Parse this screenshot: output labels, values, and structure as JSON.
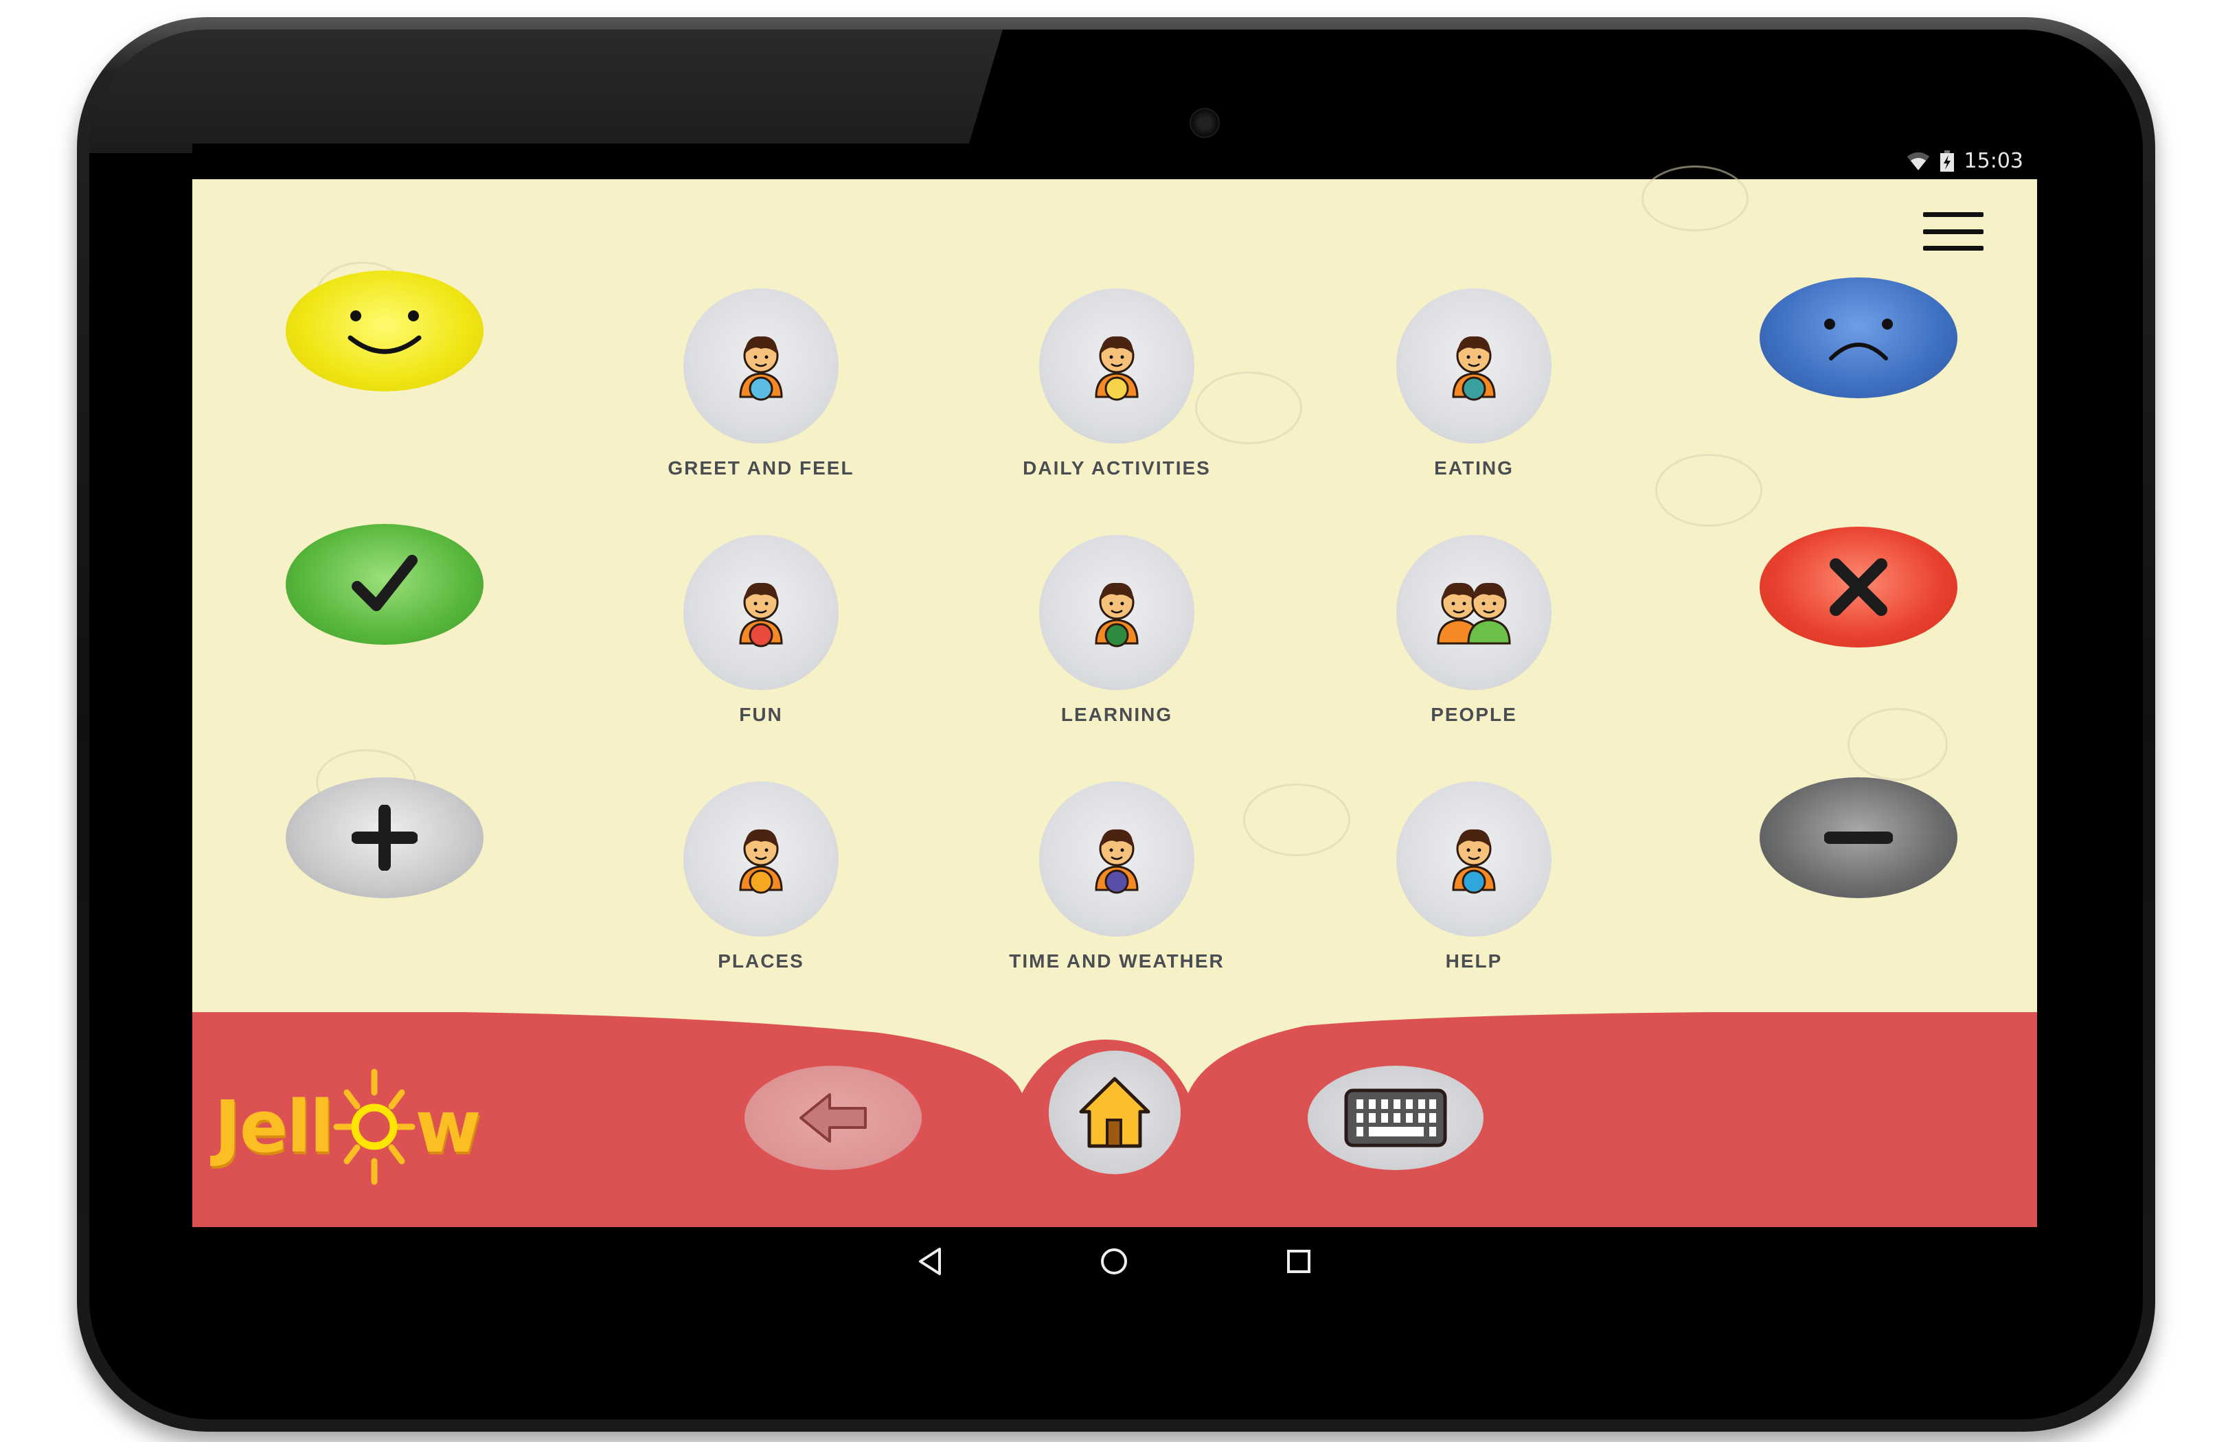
{
  "status_bar": {
    "time": "15:03",
    "icons": [
      "wifi-icon",
      "battery-charging-icon"
    ]
  },
  "header": {
    "menu_icon": "hamburger-menu-icon"
  },
  "left_actions": [
    {
      "name": "like",
      "icon": "smiley-face-icon",
      "color": "#f2ea12"
    },
    {
      "name": "yes",
      "icon": "checkmark-icon",
      "color": "#56b63d"
    },
    {
      "name": "more",
      "icon": "plus-icon",
      "color": "#c6c7c9"
    }
  ],
  "right_actions": [
    {
      "name": "dislike",
      "icon": "sad-face-icon",
      "color": "#3e6fc0"
    },
    {
      "name": "no",
      "icon": "x-icon",
      "color": "#e8402e"
    },
    {
      "name": "less",
      "icon": "minus-icon",
      "color": "#6a6b6d"
    }
  ],
  "categories": [
    {
      "label": "GREET AND FEEL",
      "icon": "boy-holding-hi-sign-icon",
      "accent": "#5bbce4"
    },
    {
      "label": "DAILY ACTIVITIES",
      "icon": "boy-with-toothbrush-icon",
      "accent": "#f5d34a"
    },
    {
      "label": "EATING",
      "icon": "boy-with-fork-spoon-icon",
      "accent": "#3aa0a0"
    },
    {
      "label": "FUN",
      "icon": "boy-with-beach-ball-icon",
      "accent": "#e84a3c"
    },
    {
      "label": "LEARNING",
      "icon": "boy-reading-book-icon",
      "accent": "#2e8a3e"
    },
    {
      "label": "PEOPLE",
      "icon": "two-children-icon",
      "accent": "#6cc04a"
    },
    {
      "label": "PLACES",
      "icon": "boy-holding-house-icon",
      "accent": "#f7a823"
    },
    {
      "label": "TIME AND WEATHER",
      "icon": "boy-holding-clock-icon",
      "accent": "#5a4fa8"
    },
    {
      "label": "HELP",
      "icon": "boy-with-question-mark-icon",
      "accent": "#2fa7dc"
    }
  ],
  "bottom_bar": {
    "logo": "Jellow",
    "back_icon": "back-arrow-icon",
    "home_icon": "home-icon",
    "keyboard_icon": "keyboard-icon",
    "color": "#dc5252"
  },
  "nav_bar": {
    "icons": [
      "nav-back-icon",
      "nav-home-icon",
      "nav-recents-icon"
    ]
  },
  "colors": {
    "background": "#f6f1c6",
    "label": "#4a4d52"
  }
}
